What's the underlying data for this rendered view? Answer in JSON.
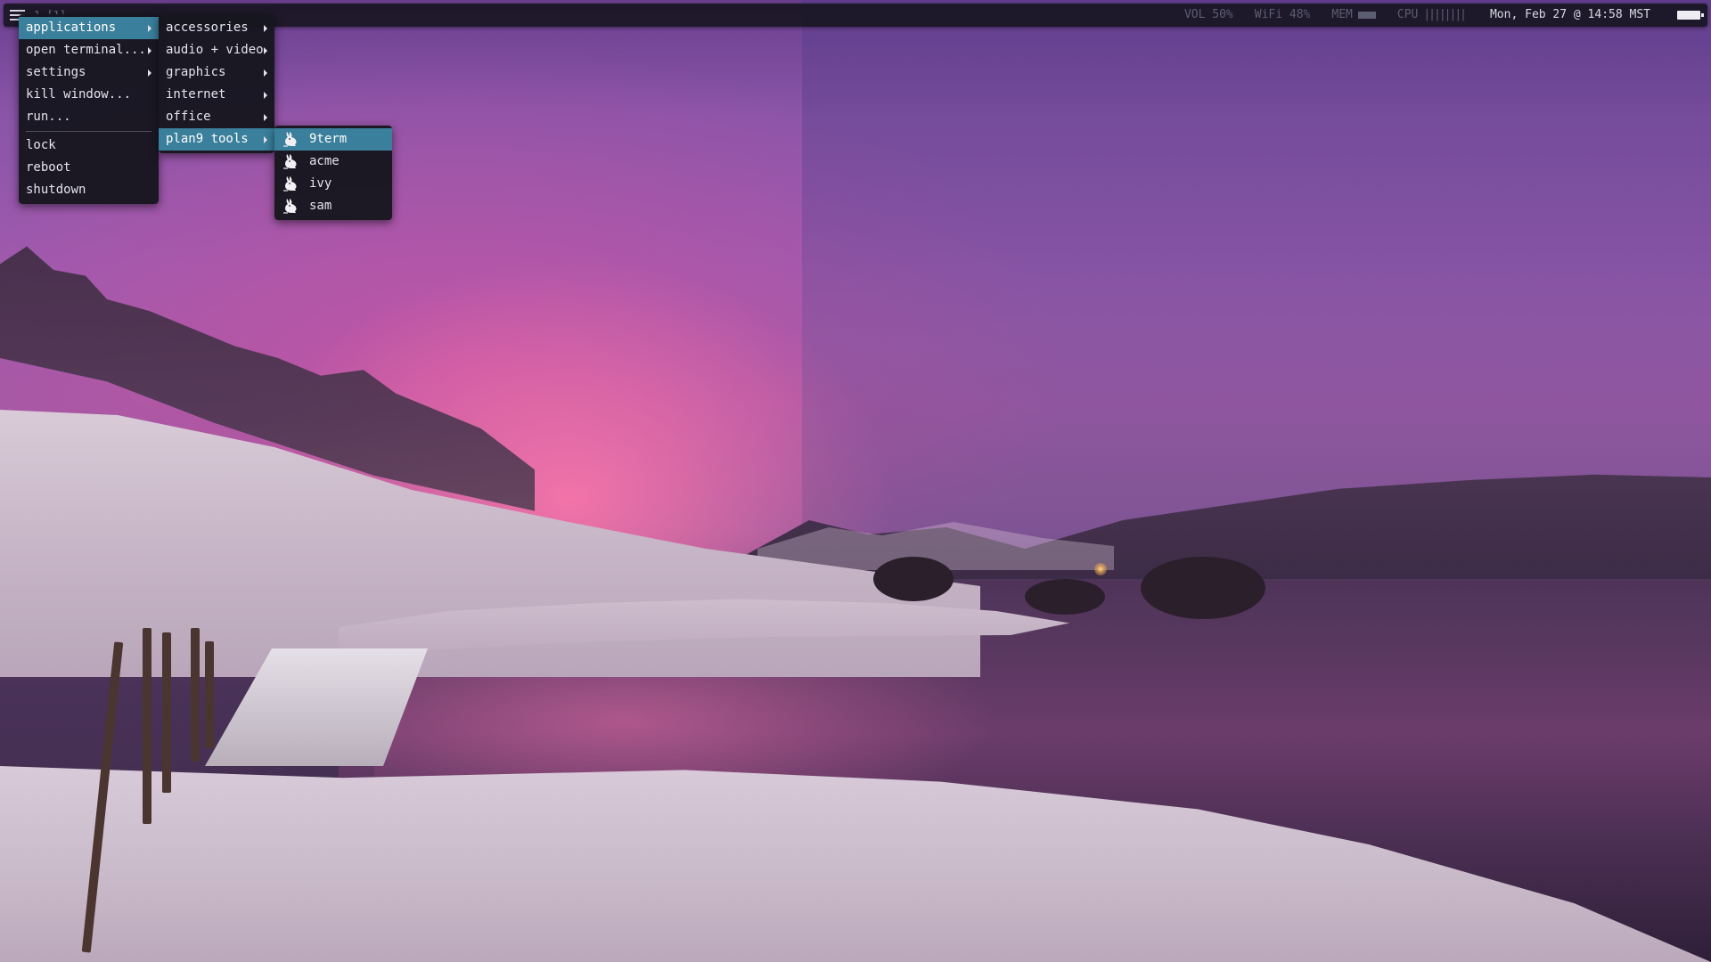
{
  "topbar": {
    "workspace_label": "1  [1]",
    "volume": "VOL 50%",
    "wifi": "WiFi 48%",
    "memory_label": "MEM",
    "cpu_label": "CPU",
    "cpu_bars": "||||||||",
    "clock": "Mon, Feb 27 @ 14:58 MST",
    "icons": [
      "menu-icon",
      "battery-icon"
    ]
  },
  "menus": {
    "root": {
      "items": [
        {
          "label": "applications",
          "submenu": true,
          "active": true
        },
        {
          "label": "open terminal...",
          "submenu": true
        },
        {
          "label": "settings",
          "submenu": true
        },
        {
          "label": "kill window..."
        },
        {
          "label": "run..."
        },
        {
          "label": "lock"
        },
        {
          "label": "reboot"
        },
        {
          "label": "shutdown"
        }
      ]
    },
    "applications": {
      "items": [
        {
          "label": "accessories",
          "submenu": true
        },
        {
          "label": "audio + video",
          "submenu": true
        },
        {
          "label": "graphics",
          "submenu": true
        },
        {
          "label": "internet",
          "submenu": true
        },
        {
          "label": "office",
          "submenu": true
        },
        {
          "label": "plan9 tools",
          "submenu": true,
          "active": true
        }
      ]
    },
    "plan9_tools": {
      "icon": "glenda-bunny-icon",
      "items": [
        {
          "label": "9term",
          "active": true
        },
        {
          "label": "acme"
        },
        {
          "label": "ivy"
        },
        {
          "label": "sam"
        }
      ]
    }
  },
  "colors": {
    "menu_bg": "#16161e",
    "highlight": "#3a7f9b",
    "text": "#e4e4ee",
    "muted_status": "#5b5d70"
  }
}
